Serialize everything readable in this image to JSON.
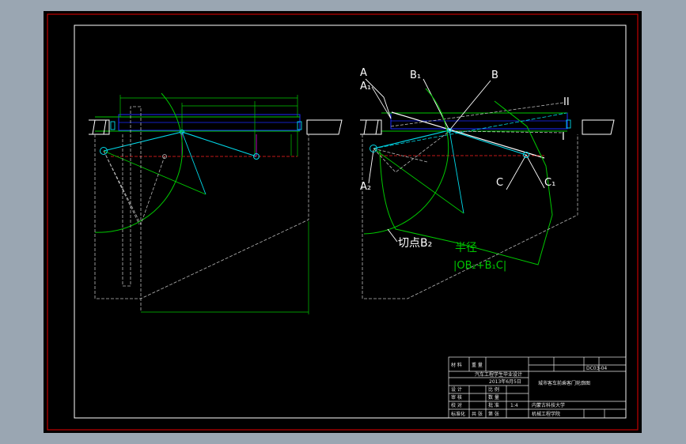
{
  "colors": {
    "paper": "#000000",
    "frame_outer": "#c00000",
    "frame_inner": "#ffffff",
    "green": "#00c800",
    "cyan": "#00d8e8",
    "blue": "#1a2cff",
    "magenta": "#d000d0",
    "red": "#ff2020",
    "white": "#ffffff",
    "gray": "#b8b8b8"
  },
  "labels": {
    "A": "A",
    "A1": "A₁",
    "A2": "A₂",
    "B": "B",
    "B1": "B₁",
    "C": "C",
    "C1": "C₁",
    "I": "I",
    "II": "II",
    "tangent_point": "切点B₂",
    "radius_title": "半径",
    "radius_formula": "|OB₂+B₁C|"
  },
  "title_block": {
    "drawing_title": "城市客车前乘客门轮廓图",
    "school_line1": "内蒙古科技大学",
    "school_line2": "机械工程学院",
    "course": "汽车工程学生毕业设计",
    "date": "2013年6月5日",
    "ratio": "1:4",
    "row_labels": [
      "设 计",
      "审 核",
      "校 对",
      "标准化",
      "批 准"
    ],
    "col_labels": [
      "材 料",
      "重 量",
      "比 例",
      "数 量",
      "共 张",
      "第 张"
    ],
    "drawing_no": "DC03-04"
  }
}
